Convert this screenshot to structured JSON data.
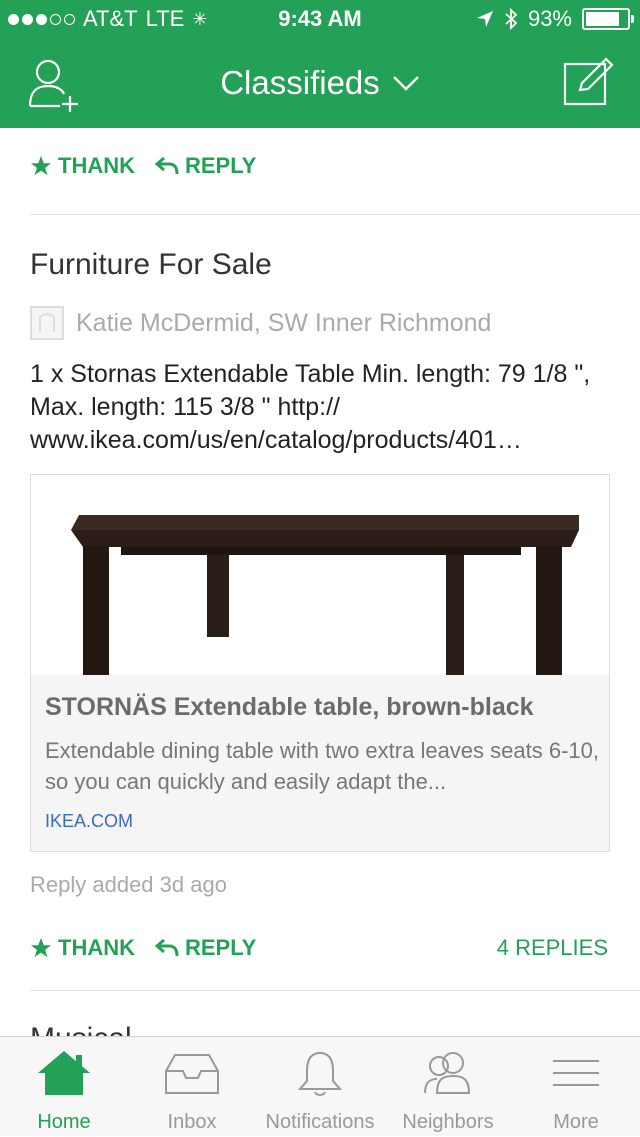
{
  "status_bar": {
    "carrier": "AT&T",
    "network": "LTE",
    "time": "9:43 AM",
    "battery": "93%",
    "battery_level": 0.93
  },
  "navbar": {
    "title": "Classifieds",
    "left_icon": "add-user-icon",
    "right_icon": "compose-icon"
  },
  "actions": {
    "thank_label": "THANK",
    "reply_label": "REPLY"
  },
  "post": {
    "title": "Furniture For Sale",
    "author": "Katie McDermid, SW Inner Richmond",
    "body": "1 x Stornas Extendable Table Min. length: 79 1/8 \", Max. length: 115 3/8 \" http:// www.ikea.com/us/en/catalog/products/401…",
    "link_card": {
      "title": "STORNÄS Extendable table, brown-black",
      "description": "Extendable dining table with two extra leaves seats 6-10, so you can quickly and easily adapt the...",
      "site": "IKEA.COM"
    },
    "meta": "Reply added 3d ago",
    "replies": "4 REPLIES"
  },
  "next_post_peek": "Musical",
  "tabbar": {
    "items": [
      {
        "label": "Home",
        "icon": "home-icon",
        "active": true
      },
      {
        "label": "Inbox",
        "icon": "inbox-icon",
        "active": false
      },
      {
        "label": "Notifications",
        "icon": "bell-icon",
        "active": false
      },
      {
        "label": "Neighbors",
        "icon": "neighbors-icon",
        "active": false
      },
      {
        "label": "More",
        "icon": "menu-icon",
        "active": false
      }
    ]
  },
  "colors": {
    "brand_green": "#23a157",
    "link_blue": "#3a6bbd"
  }
}
